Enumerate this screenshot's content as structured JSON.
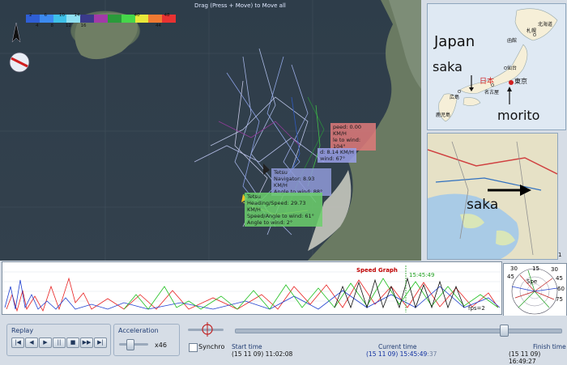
{
  "map": {
    "drag_hint": "Drag (Press + Move) to Move all",
    "speed_scale": {
      "colors": [
        "#2f5fd6",
        "#3c8af0",
        "#3ec0e8",
        "#8fe0f2",
        "#3a3a8a",
        "#a23aa8",
        "#2a9a3a",
        "#46d64a",
        "#e8e83a",
        "#f07a32",
        "#e83232"
      ],
      "top_labels": [
        "2",
        "6",
        "10",
        "14",
        "",
        "",
        "",
        "40",
        "",
        "48"
      ],
      "bottom_labels": [
        "4",
        "8",
        "12",
        "16",
        "",
        "",
        "",
        "",
        "44",
        ""
      ]
    },
    "boat_labels": [
      {
        "lines": [
          "peed: 0.00 KM/H",
          "le to wind: 104°"
        ],
        "bg": "#e07a7a"
      },
      {
        "lines": [
          "d: 8.14 KM/H",
          "wind: 67°"
        ],
        "bg": "#9aa0e8"
      },
      {
        "lines": [
          "Tetsu",
          "Navigator: 8.93 KM/H",
          "Angle to wind: 88°"
        ],
        "bg": "#8f9ad8"
      },
      {
        "lines": [
          "Tetsu",
          "Heading/Speed: 29.73 KM/H",
          "Speed/Angle to wind: 61°",
          "Angle to wind: 2°"
        ],
        "bg": "#6cd06c"
      }
    ]
  },
  "japan_map": {
    "labels": {
      "japan": "Japan",
      "saka": "saka",
      "morito": "morito",
      "nihon": "日本",
      "tokyo": "東京",
      "hokkaido": "北海道",
      "sapporo": "札幌",
      "hakodate": "函館",
      "sendai": "仙台",
      "hiroshima": "広島",
      "nagoya": "名古屋",
      "kagoshima": "鹿児島"
    }
  },
  "detail_map": {
    "label": "saka"
  },
  "page_number": "1",
  "graph": {
    "title": "Speed Graph",
    "time_marker": "15:45:49",
    "fps": "fps=2"
  },
  "compass": {
    "labels": [
      "30",
      "15",
      "30",
      "45",
      "60",
      "75",
      "45",
      "Spe"
    ]
  },
  "controls": {
    "replay_title": "Replay",
    "replay_buttons": [
      "|◀",
      "◀",
      "▶",
      "||",
      "■",
      "▶▶",
      "▶|"
    ],
    "acceleration_title": "Acceleration",
    "acceleration_value": "x46",
    "synchro_label": "Synchro",
    "start_time_label": "Start time",
    "start_time_value": "(15 11 09) 11:02:08",
    "current_time_label": "Current time",
    "current_time_main": "(15 11 09) 15:45:49",
    "current_time_frac": ":37",
    "finish_time_label": "Finish time",
    "finish_time_value": "(15 11 09) 16:49:27"
  }
}
